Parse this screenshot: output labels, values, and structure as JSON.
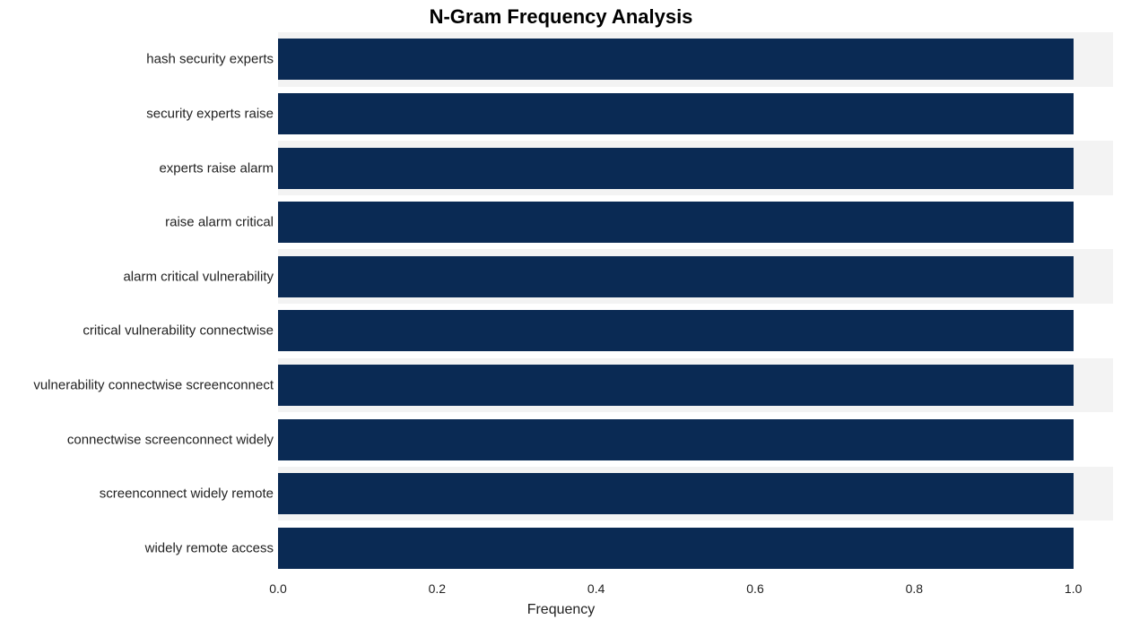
{
  "chart_data": {
    "type": "bar",
    "orientation": "horizontal",
    "title": "N-Gram Frequency Analysis",
    "xlabel": "Frequency",
    "ylabel": "",
    "xlim": [
      0.0,
      1.05
    ],
    "xticks": [
      0.0,
      0.2,
      0.4,
      0.6,
      0.8,
      1.0
    ],
    "categories": [
      "hash security experts",
      "security experts raise",
      "experts raise alarm",
      "raise alarm critical",
      "alarm critical vulnerability",
      "critical vulnerability connectwise",
      "vulnerability connectwise screenconnect",
      "connectwise screenconnect widely",
      "screenconnect widely remote",
      "widely remote access"
    ],
    "values": [
      1.0,
      1.0,
      1.0,
      1.0,
      1.0,
      1.0,
      1.0,
      1.0,
      1.0,
      1.0
    ],
    "bar_color": "#0a2a54"
  }
}
